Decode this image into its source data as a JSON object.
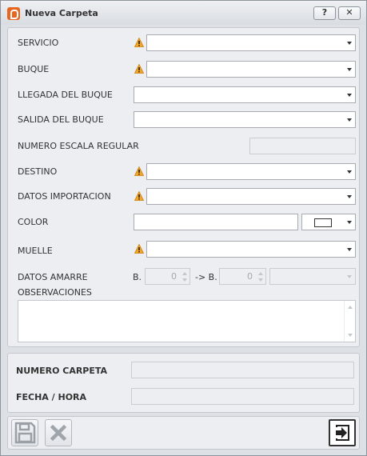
{
  "window": {
    "title": "Nueva Carpeta",
    "help_label": "?",
    "close_label": "✕"
  },
  "form": {
    "servicio": {
      "label": "SERVICIO",
      "value": ""
    },
    "buque": {
      "label": "BUQUE",
      "value": ""
    },
    "llegada": {
      "label": "LLEGADA DEL BUQUE",
      "value": ""
    },
    "salida": {
      "label": "SALIDA DEL BUQUE",
      "value": ""
    },
    "numero_escala": {
      "label": "NUMERO ESCALA REGULAR",
      "value": ""
    },
    "destino": {
      "label": "DESTINO",
      "value": ""
    },
    "datos_importacion": {
      "label": "DATOS IMPORTACION",
      "value": ""
    },
    "color": {
      "label": "COLOR",
      "value": ""
    },
    "muelle": {
      "label": "MUELLE",
      "value": ""
    },
    "datos_amarre": {
      "label": "DATOS AMARRE",
      "from_prefix": "B.",
      "from_value": "0",
      "to_prefix": "-> B.",
      "to_value": "0",
      "side_value": ""
    },
    "observaciones": {
      "label": "OBSERVACIONES",
      "value": ""
    }
  },
  "summary": {
    "numero_carpeta": {
      "label": "NUMERO CARPETA",
      "value": ""
    },
    "fecha_hora": {
      "label": "FECHA / HORA",
      "value": ""
    }
  },
  "icons": {
    "warning": "warning-icon",
    "save": "save-icon",
    "cancel": "cancel-icon",
    "exit": "exit-icon"
  },
  "colors": {
    "warning": "#f5a623",
    "brand": "#e8651f"
  }
}
